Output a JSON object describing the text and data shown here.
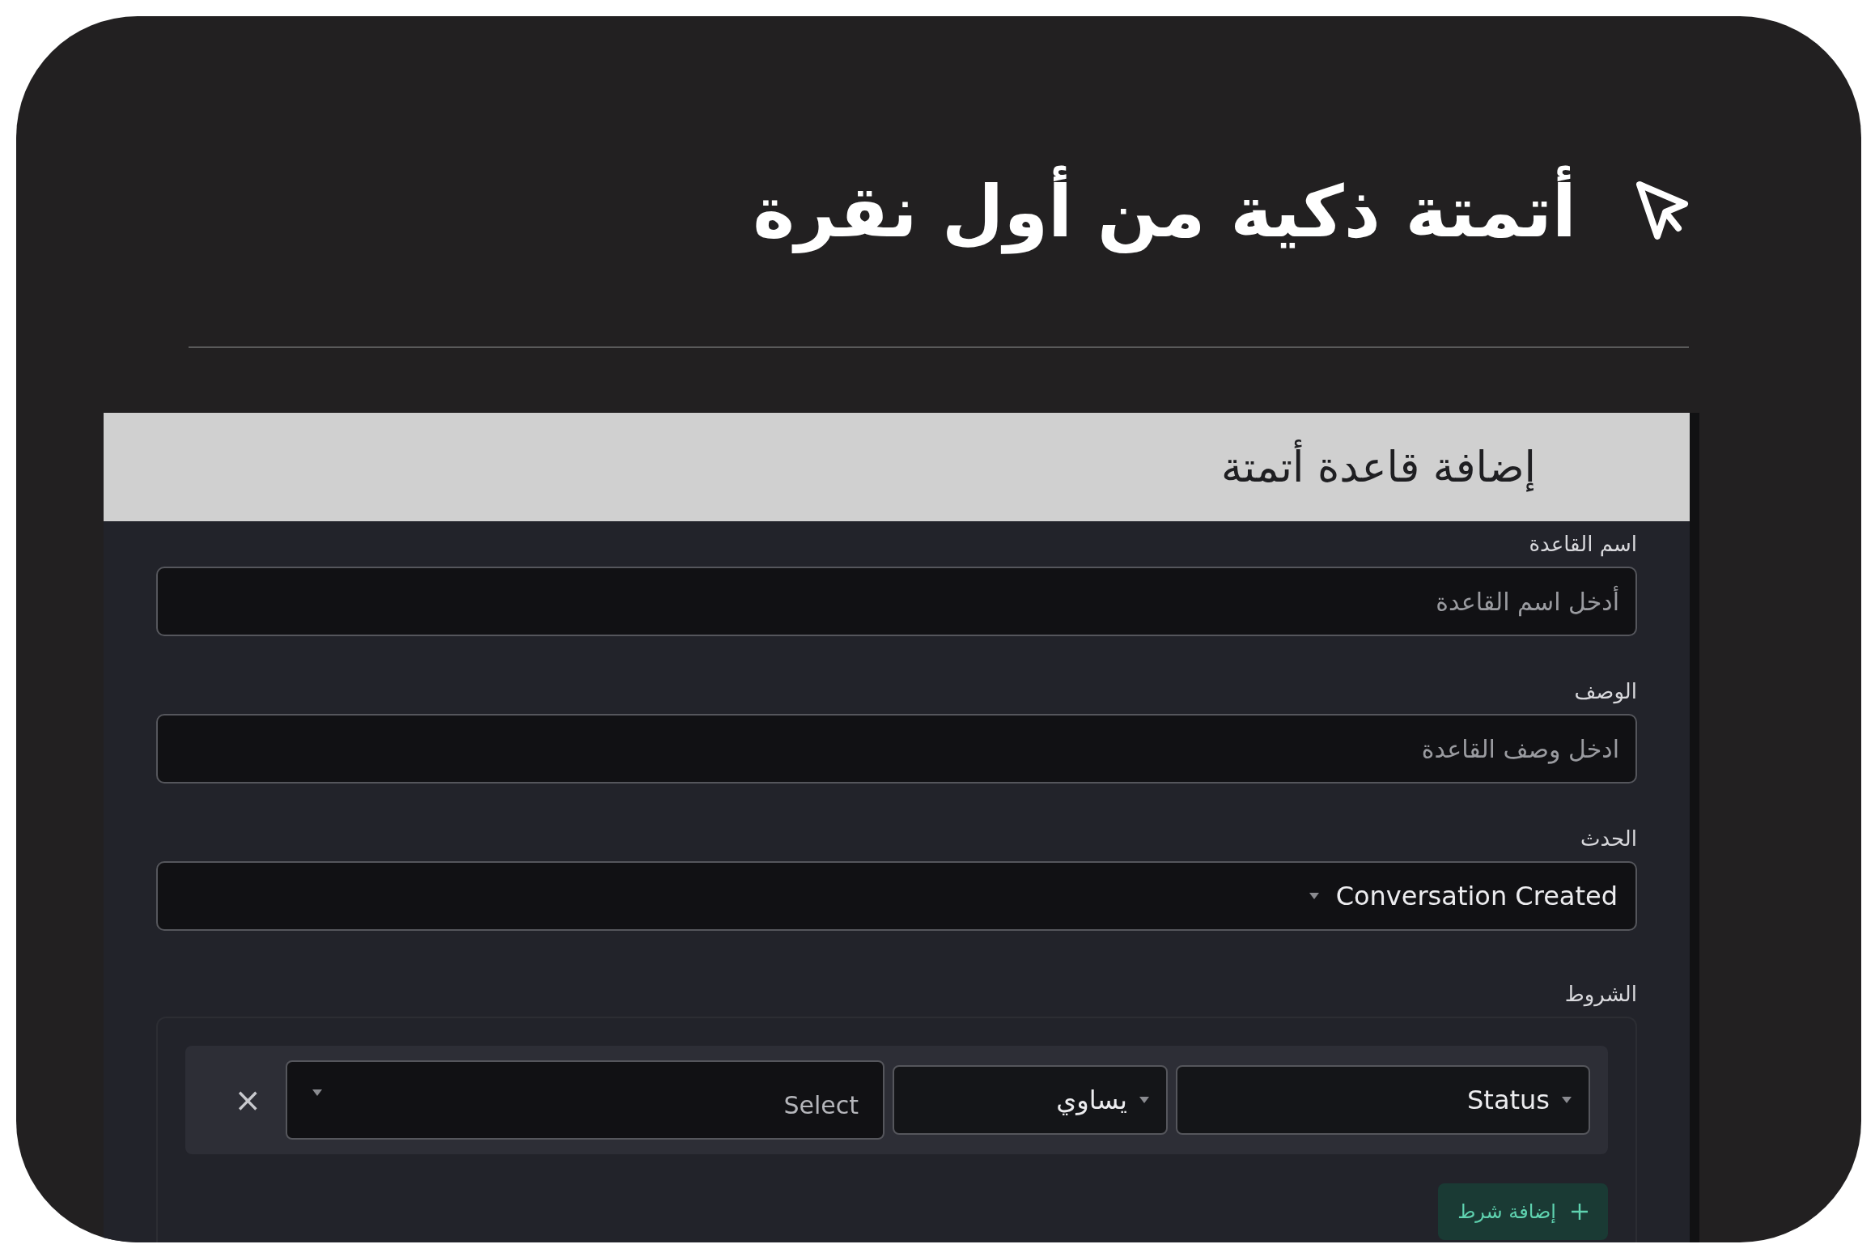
{
  "headline": "أتمتة ذكية من أول نقرة",
  "dialog": {
    "title": "إضافة قاعدة أتمتة",
    "fields": [
      {
        "kind": "input",
        "label": "اسم القاعدة",
        "placeholder": "أدخل اسم القاعدة"
      },
      {
        "kind": "input",
        "label": "الوصف",
        "placeholder": "ادخل وصف القاعدة"
      },
      {
        "kind": "select",
        "label": "الحدث",
        "value": "Conversation Created"
      }
    ],
    "conditions": {
      "label": "الشروط",
      "rows": [
        {
          "attribute": "Status",
          "operator": "يساوي",
          "value_placeholder": "Select",
          "remove": "×"
        }
      ],
      "add_button": "إضافة شرط"
    }
  }
}
